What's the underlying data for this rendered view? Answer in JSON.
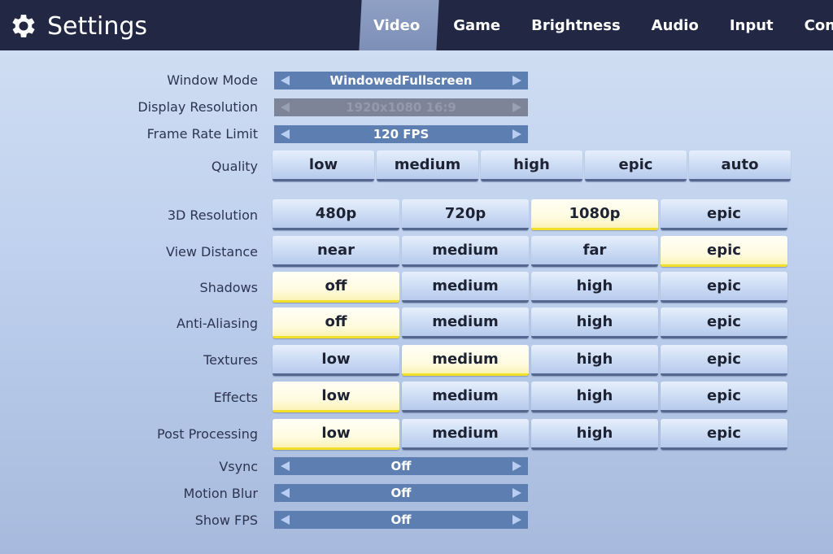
{
  "header": {
    "title": "Settings",
    "icon": "gear-icon",
    "tabs": [
      {
        "label": "Video",
        "active": true
      },
      {
        "label": "Game",
        "active": false
      },
      {
        "label": "Brightness",
        "active": false
      },
      {
        "label": "Audio",
        "active": false
      },
      {
        "label": "Input",
        "active": false
      },
      {
        "label": "Contr",
        "active": false
      }
    ]
  },
  "selectors_top": [
    {
      "label": "Window Mode",
      "value": "WindowedFullscreen",
      "disabled": false
    },
    {
      "label": "Display Resolution",
      "value": "1920x1080 16:9",
      "disabled": true
    },
    {
      "label": "Frame Rate Limit",
      "value": "120 FPS",
      "disabled": false
    }
  ],
  "quality": {
    "label": "Quality",
    "options": [
      "low",
      "medium",
      "high",
      "epic",
      "auto"
    ],
    "selected": null
  },
  "option_rows": [
    {
      "label": "3D Resolution",
      "options": [
        "480p",
        "720p",
        "1080p",
        "epic"
      ],
      "selected": 2
    },
    {
      "label": "View Distance",
      "options": [
        "near",
        "medium",
        "far",
        "epic"
      ],
      "selected": 3
    },
    {
      "label": "Shadows",
      "options": [
        "off",
        "medium",
        "high",
        "epic"
      ],
      "selected": 0
    },
    {
      "label": "Anti-Aliasing",
      "options": [
        "off",
        "medium",
        "high",
        "epic"
      ],
      "selected": 0
    },
    {
      "label": "Textures",
      "options": [
        "low",
        "medium",
        "high",
        "epic"
      ],
      "selected": 1
    },
    {
      "label": "Effects",
      "options": [
        "low",
        "medium",
        "high",
        "epic"
      ],
      "selected": 0
    },
    {
      "label": "Post Processing",
      "options": [
        "low",
        "medium",
        "high",
        "epic"
      ],
      "selected": 0
    }
  ],
  "selectors_bottom": [
    {
      "label": "Vsync",
      "value": "Off",
      "disabled": false
    },
    {
      "label": "Motion Blur",
      "value": "Off",
      "disabled": false
    },
    {
      "label": "Show FPS",
      "value": "Off",
      "disabled": false
    }
  ],
  "colors": {
    "header_bg": "#222843",
    "selector_bg": "#5d7eb1",
    "selected_highlight": "#f1df2a"
  }
}
